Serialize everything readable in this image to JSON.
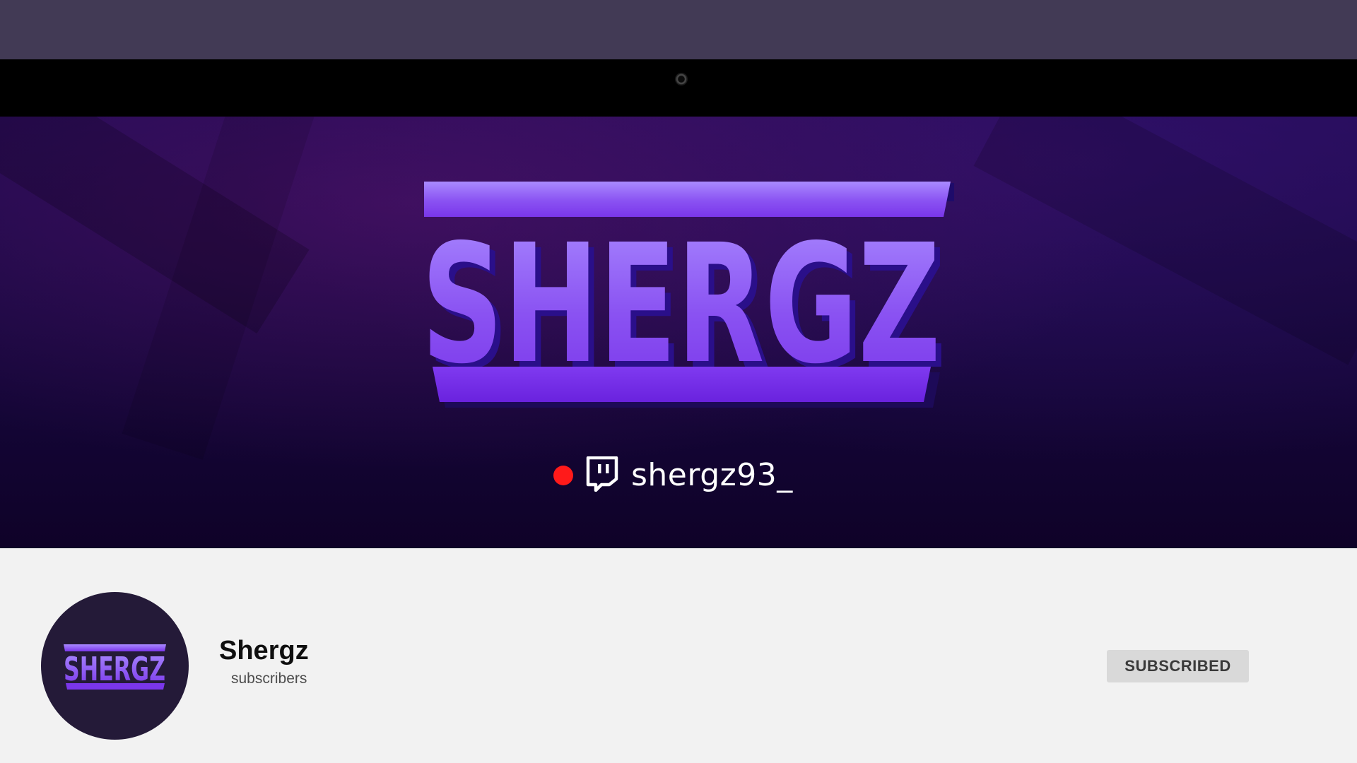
{
  "banner": {
    "logo_text": "SHERGZ",
    "live_indicator_color": "#ff1a1a",
    "platform_icon": "twitch-icon",
    "handle": "shergz93_"
  },
  "channel": {
    "name": "Shergz",
    "subscribers_text": "subscribers",
    "avatar_logo_text": "SHERGZ",
    "subscribe_button_label": "SUBSCRIBED"
  },
  "colors": {
    "top_bar": "#423a55",
    "banner_dark": "#170840",
    "logo_purple": "#8c55f5",
    "page_background": "#f2f2f2",
    "button_background": "#d9d9d9"
  }
}
